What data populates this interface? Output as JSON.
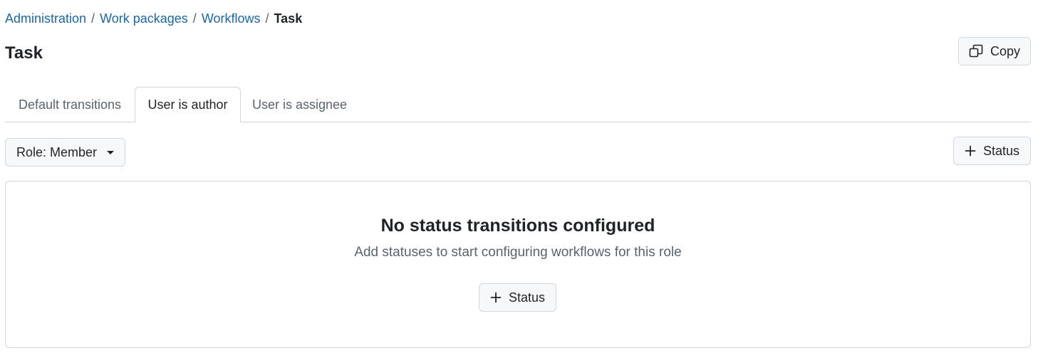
{
  "breadcrumb": {
    "items": [
      "Administration",
      "Work packages",
      "Workflows"
    ],
    "separator": "/",
    "current": "Task"
  },
  "page_title": "Task",
  "header_actions": {
    "copy_label": "Copy",
    "copy_icon": "copy-icon"
  },
  "tabs": [
    {
      "label": "Default transitions",
      "active": false
    },
    {
      "label": "User is author",
      "active": true
    },
    {
      "label": "User is assignee",
      "active": false
    }
  ],
  "toolbar": {
    "role_label": "Role: Member",
    "role_icon": "chevron-down-icon",
    "status_label": "Status",
    "status_icon": "plus-icon"
  },
  "blankslate": {
    "title": "No status transitions configured",
    "description": "Add statuses to start configuring workflows for this role",
    "button_label": "Status",
    "button_icon": "plus-icon"
  },
  "colors": {
    "link": "#1a67a3",
    "text": "#1f2328",
    "muted": "#59636e",
    "border": "#d0d7de",
    "button_bg": "#f6f8fa"
  }
}
